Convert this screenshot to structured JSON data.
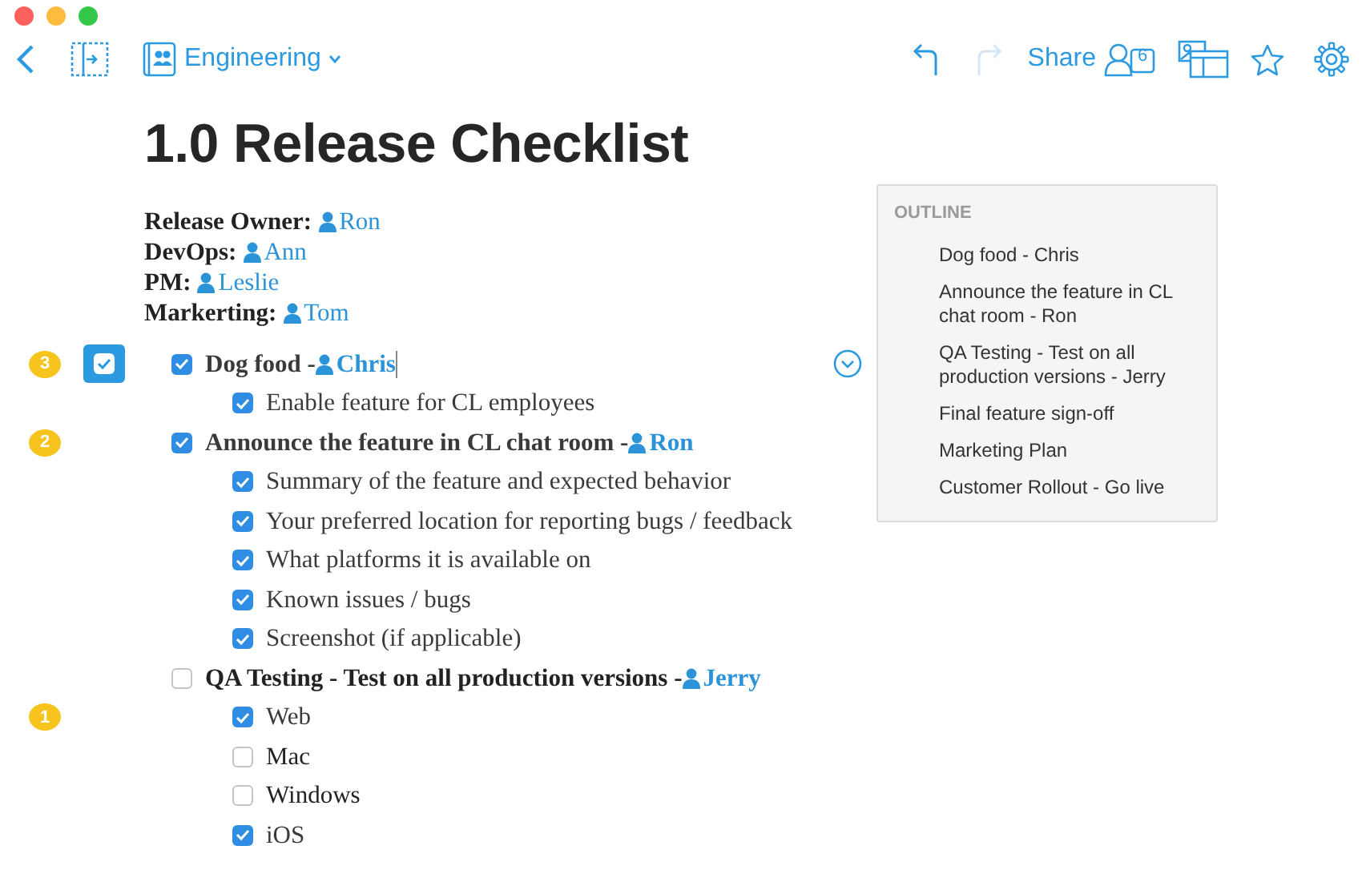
{
  "toolbar": {
    "team": "Engineering",
    "share_label": "Share",
    "share_count": "6",
    "history": [
      {
        "kind": "undo",
        "disabled": false
      },
      {
        "kind": "redo",
        "disabled": true
      }
    ]
  },
  "document": {
    "title": "1.0 Release Checklist",
    "meta": [
      {
        "label": "Release Owner:",
        "person": "Ron"
      },
      {
        "label": "DevOps:",
        "person": "Ann"
      },
      {
        "label": "PM:",
        "person": "Leslie"
      },
      {
        "label": "Markerting:",
        "person": "Tom"
      }
    ],
    "items": [
      {
        "text": "Dog food - ",
        "assignee": "Chris",
        "checked": true,
        "comments": "3",
        "selected": true,
        "children": [
          {
            "text": "Enable feature for CL employees",
            "checked": true
          }
        ]
      },
      {
        "text": "Announce the feature in CL chat room - ",
        "assignee": "Ron",
        "checked": true,
        "comments": "2",
        "selected": false,
        "children": [
          {
            "text": "Summary of the feature and expected behavior",
            "checked": true
          },
          {
            "text": "Your preferred location for reporting bugs / feedback",
            "checked": true
          },
          {
            "text": "What platforms it is available on",
            "checked": true
          },
          {
            "text": "Known issues / bugs",
            "checked": true
          },
          {
            "text": "Screenshot (if applicable)",
            "checked": true
          }
        ]
      },
      {
        "text": "QA Testing - Test on all production versions - ",
        "assignee": "Jerry",
        "checked": false,
        "selected": false,
        "children": [
          {
            "text": "Web",
            "checked": true,
            "comments": "1"
          },
          {
            "text": "Mac",
            "checked": false
          },
          {
            "text": "Windows",
            "checked": false
          },
          {
            "text": "iOS",
            "checked": true
          }
        ]
      }
    ]
  },
  "outline": {
    "title": "OUTLINE",
    "items": [
      "Dog food - Chris",
      "Announce the feature in CL chat room - Ron",
      "QA Testing - Test on all production versions - Jerry",
      "Final feature sign-off",
      "Marketing Plan",
      "Customer Rollout - Go live"
    ]
  }
}
